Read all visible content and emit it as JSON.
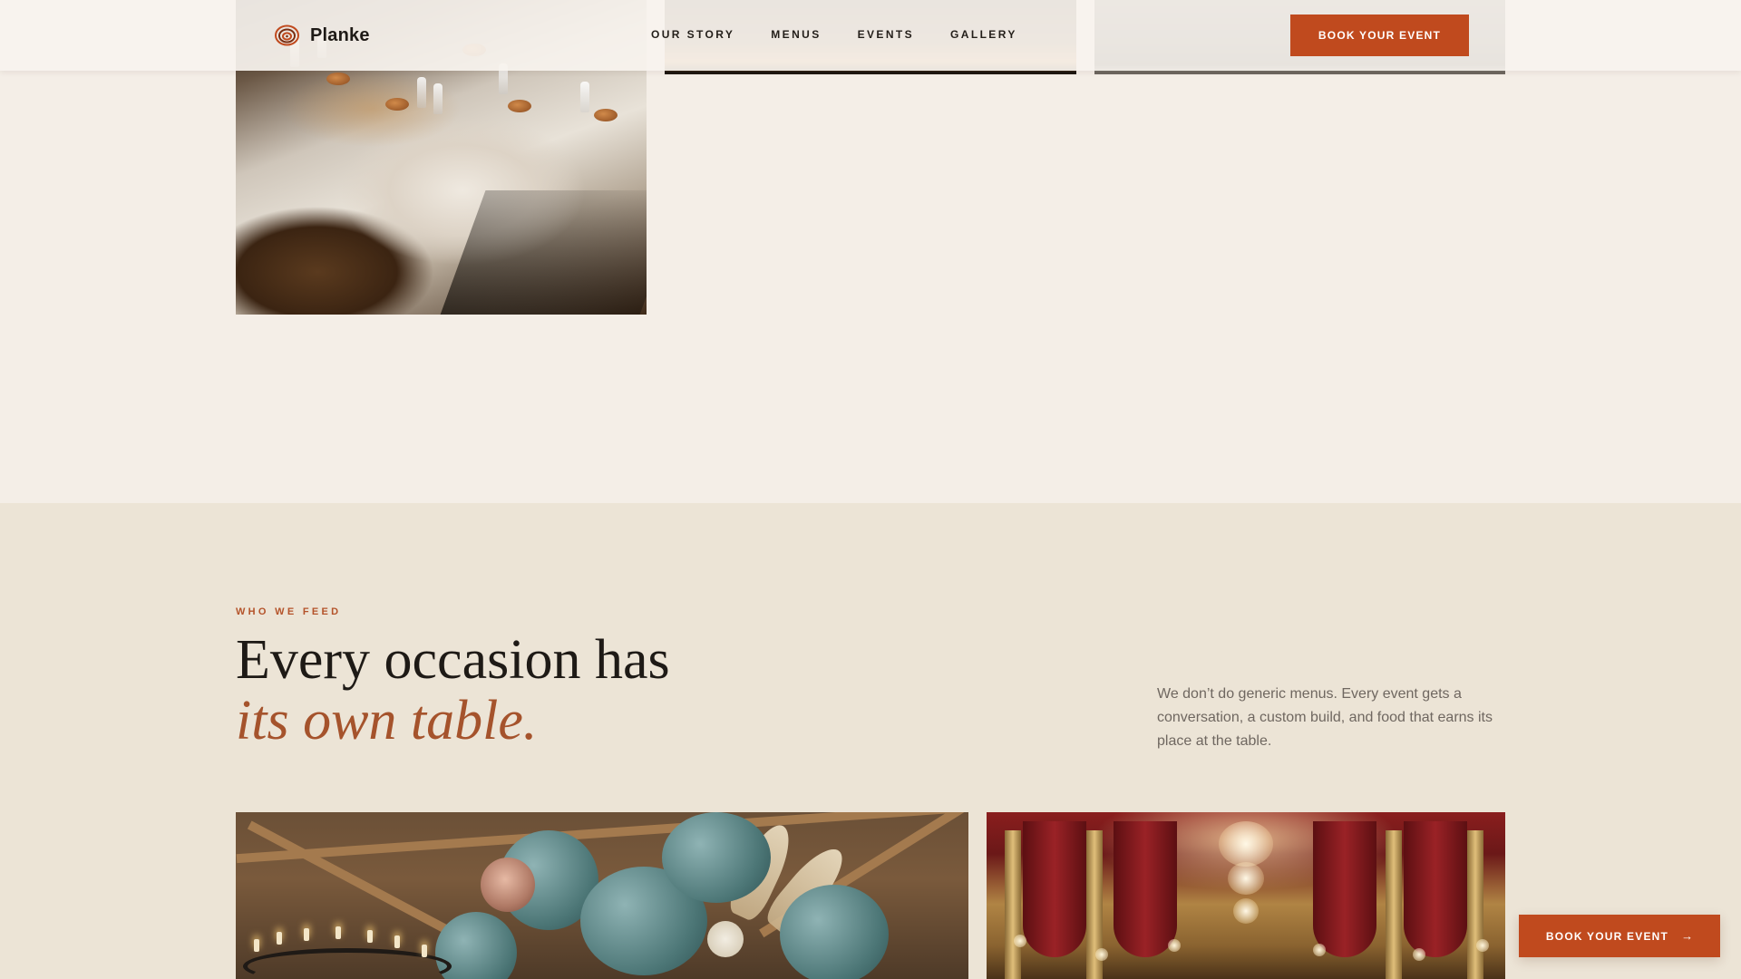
{
  "brand": {
    "name": "Planke",
    "logo_icon": "spiral-logo-icon",
    "accent": "#c04a1e"
  },
  "nav": {
    "items": [
      {
        "label": "OUR STORY"
      },
      {
        "label": "MENUS"
      },
      {
        "label": "EVENTS"
      },
      {
        "label": "GALLERY"
      }
    ],
    "cta_label": "BOOK YOUR EVENT"
  },
  "feed": {
    "eyebrow": "WHO WE FEED",
    "headline_line1": "Every occasion has",
    "headline_line2": "its own table.",
    "intro": "We don’t do generic menus. Every event gets a conversation, a custom build, and food that earns its place at the table."
  },
  "floating_cta": {
    "label": "BOOK YOUR EVENT",
    "arrow": "→"
  }
}
